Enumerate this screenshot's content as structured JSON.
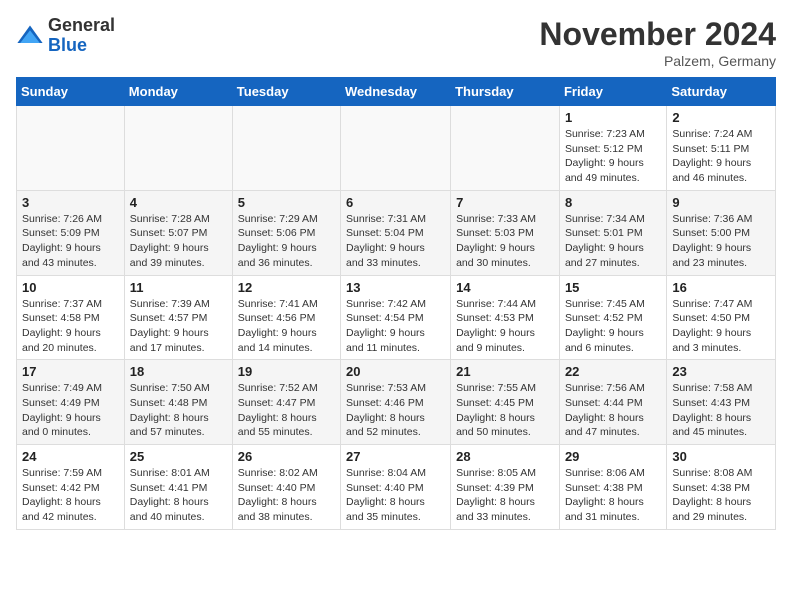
{
  "header": {
    "logo_general": "General",
    "logo_blue": "Blue",
    "month_title": "November 2024",
    "location": "Palzem, Germany"
  },
  "days_of_week": [
    "Sunday",
    "Monday",
    "Tuesday",
    "Wednesday",
    "Thursday",
    "Friday",
    "Saturday"
  ],
  "weeks": [
    [
      null,
      null,
      null,
      null,
      null,
      {
        "day": 1,
        "sunrise": "7:23 AM",
        "sunset": "5:12 PM",
        "daylight": "9 hours and 49 minutes."
      },
      {
        "day": 2,
        "sunrise": "7:24 AM",
        "sunset": "5:11 PM",
        "daylight": "9 hours and 46 minutes."
      }
    ],
    [
      {
        "day": 3,
        "sunrise": "7:26 AM",
        "sunset": "5:09 PM",
        "daylight": "9 hours and 43 minutes."
      },
      {
        "day": 4,
        "sunrise": "7:28 AM",
        "sunset": "5:07 PM",
        "daylight": "9 hours and 39 minutes."
      },
      {
        "day": 5,
        "sunrise": "7:29 AM",
        "sunset": "5:06 PM",
        "daylight": "9 hours and 36 minutes."
      },
      {
        "day": 6,
        "sunrise": "7:31 AM",
        "sunset": "5:04 PM",
        "daylight": "9 hours and 33 minutes."
      },
      {
        "day": 7,
        "sunrise": "7:33 AM",
        "sunset": "5:03 PM",
        "daylight": "9 hours and 30 minutes."
      },
      {
        "day": 8,
        "sunrise": "7:34 AM",
        "sunset": "5:01 PM",
        "daylight": "9 hours and 27 minutes."
      },
      {
        "day": 9,
        "sunrise": "7:36 AM",
        "sunset": "5:00 PM",
        "daylight": "9 hours and 23 minutes."
      }
    ],
    [
      {
        "day": 10,
        "sunrise": "7:37 AM",
        "sunset": "4:58 PM",
        "daylight": "9 hours and 20 minutes."
      },
      {
        "day": 11,
        "sunrise": "7:39 AM",
        "sunset": "4:57 PM",
        "daylight": "9 hours and 17 minutes."
      },
      {
        "day": 12,
        "sunrise": "7:41 AM",
        "sunset": "4:56 PM",
        "daylight": "9 hours and 14 minutes."
      },
      {
        "day": 13,
        "sunrise": "7:42 AM",
        "sunset": "4:54 PM",
        "daylight": "9 hours and 11 minutes."
      },
      {
        "day": 14,
        "sunrise": "7:44 AM",
        "sunset": "4:53 PM",
        "daylight": "9 hours and 9 minutes."
      },
      {
        "day": 15,
        "sunrise": "7:45 AM",
        "sunset": "4:52 PM",
        "daylight": "9 hours and 6 minutes."
      },
      {
        "day": 16,
        "sunrise": "7:47 AM",
        "sunset": "4:50 PM",
        "daylight": "9 hours and 3 minutes."
      }
    ],
    [
      {
        "day": 17,
        "sunrise": "7:49 AM",
        "sunset": "4:49 PM",
        "daylight": "9 hours and 0 minutes."
      },
      {
        "day": 18,
        "sunrise": "7:50 AM",
        "sunset": "4:48 PM",
        "daylight": "8 hours and 57 minutes."
      },
      {
        "day": 19,
        "sunrise": "7:52 AM",
        "sunset": "4:47 PM",
        "daylight": "8 hours and 55 minutes."
      },
      {
        "day": 20,
        "sunrise": "7:53 AM",
        "sunset": "4:46 PM",
        "daylight": "8 hours and 52 minutes."
      },
      {
        "day": 21,
        "sunrise": "7:55 AM",
        "sunset": "4:45 PM",
        "daylight": "8 hours and 50 minutes."
      },
      {
        "day": 22,
        "sunrise": "7:56 AM",
        "sunset": "4:44 PM",
        "daylight": "8 hours and 47 minutes."
      },
      {
        "day": 23,
        "sunrise": "7:58 AM",
        "sunset": "4:43 PM",
        "daylight": "8 hours and 45 minutes."
      }
    ],
    [
      {
        "day": 24,
        "sunrise": "7:59 AM",
        "sunset": "4:42 PM",
        "daylight": "8 hours and 42 minutes."
      },
      {
        "day": 25,
        "sunrise": "8:01 AM",
        "sunset": "4:41 PM",
        "daylight": "8 hours and 40 minutes."
      },
      {
        "day": 26,
        "sunrise": "8:02 AM",
        "sunset": "4:40 PM",
        "daylight": "8 hours and 38 minutes."
      },
      {
        "day": 27,
        "sunrise": "8:04 AM",
        "sunset": "4:40 PM",
        "daylight": "8 hours and 35 minutes."
      },
      {
        "day": 28,
        "sunrise": "8:05 AM",
        "sunset": "4:39 PM",
        "daylight": "8 hours and 33 minutes."
      },
      {
        "day": 29,
        "sunrise": "8:06 AM",
        "sunset": "4:38 PM",
        "daylight": "8 hours and 31 minutes."
      },
      {
        "day": 30,
        "sunrise": "8:08 AM",
        "sunset": "4:38 PM",
        "daylight": "8 hours and 29 minutes."
      }
    ]
  ],
  "labels": {
    "sunrise": "Sunrise:",
    "sunset": "Sunset:",
    "daylight": "Daylight:"
  }
}
